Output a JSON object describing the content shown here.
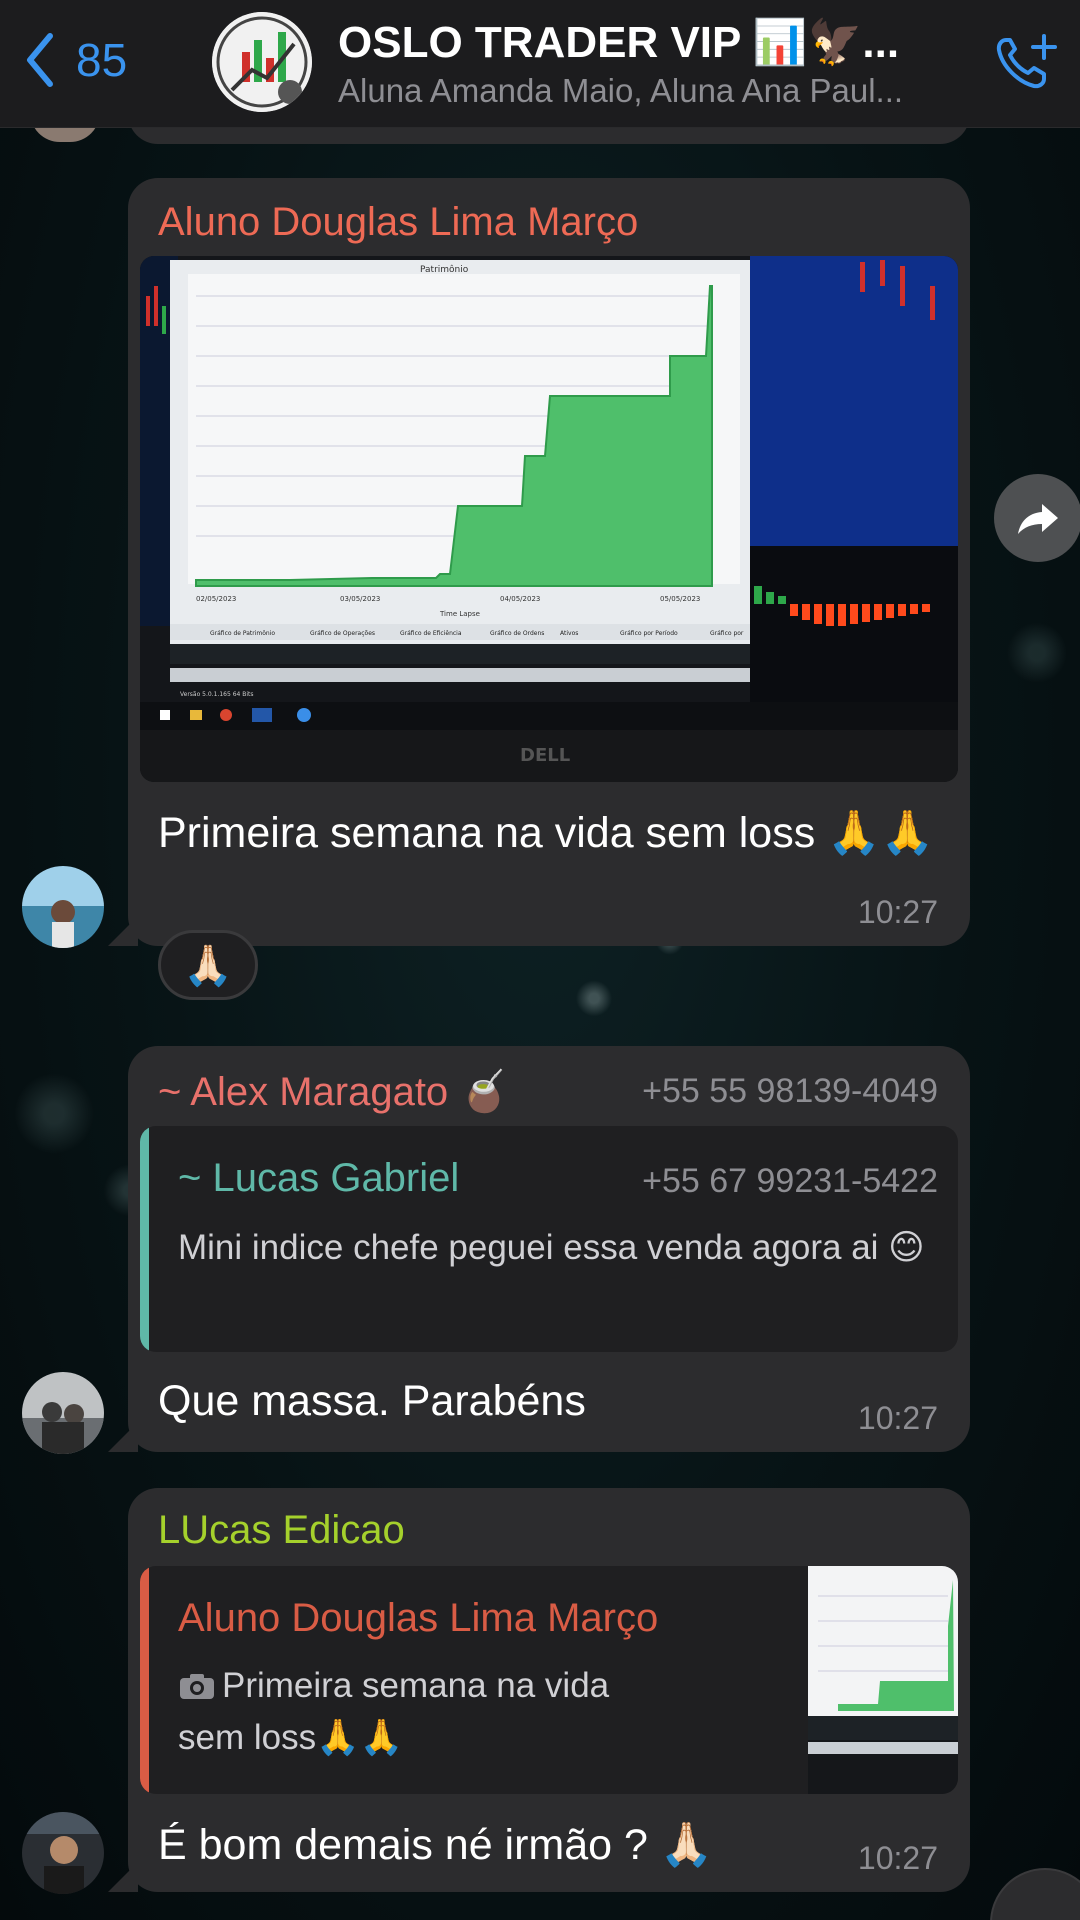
{
  "header": {
    "back_count": "85",
    "title": "OSLO TRADER VIP 📊🦅...",
    "subtitle": "Aluna Amanda Maio, Aluna Ana Paul..."
  },
  "messages": [
    {
      "sender": "Aluno Douglas Lima Março",
      "sender_color": "#ee6a55",
      "text": "Primeira semana na vida sem loss 🙏🙏",
      "time": "10:27",
      "reaction": "🙏🏻",
      "photo": {
        "chart_title": "Patrimônio",
        "legend": "Time Lapse",
        "x_dates": [
          "02/05/2023",
          "03/05/2023",
          "04/05/2023",
          "05/05/2023"
        ],
        "tabs": [
          "Gráfico de Patrimônio",
          "Gráfico de Operações",
          "Gráfico de Eficiência",
          "Gráfico de Ordens",
          "Ativos",
          "Gráfico por Período",
          "Gráfico por"
        ],
        "version": "Versão 5.0.1.165 64 Bits",
        "monitor_brand": "DELL"
      }
    },
    {
      "sender": "~ Alex Maragato 🧉",
      "sender_color": "#e8716b",
      "phone": "+55 55 98139-4049",
      "reply_sender": "~ Lucas Gabriel",
      "reply_sender_color": "#5fb8a8",
      "reply_phone": "+55 67 99231-5422",
      "reply_text": "Mini indice chefe peguei essa venda agora ai 😊",
      "text": "Que massa. Parabéns",
      "time": "10:27"
    },
    {
      "sender": "LUcas Edicao",
      "sender_color": "#a5d12c",
      "reply_sender": "Aluno Douglas Lima Março",
      "reply_sender_color": "#d95c45",
      "reply_text": "Primeira semana na vida sem loss🙏🙏",
      "text": "É bom demais né irmão ? 🙏🏻",
      "time": "10:27"
    }
  ],
  "colors": {
    "accent": "#3a93ee",
    "bubble": "#2c2c2e",
    "chart_fill": "#4fbf6b"
  }
}
